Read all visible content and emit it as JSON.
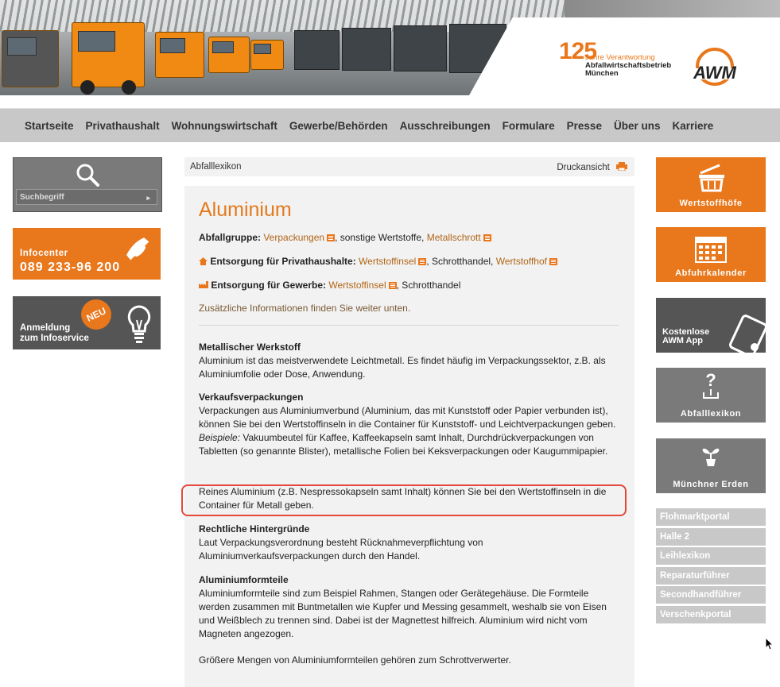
{
  "header": {
    "jubilee_number": "125",
    "jubilee_line1": "Jahre Verantwortung",
    "jubilee_line2": "Abfallwirtschaftsbetrieb",
    "jubilee_line3": "München",
    "logo_text": "AWM"
  },
  "nav": {
    "items": [
      "Startseite",
      "Privathaushalt",
      "Wohnungswirtschaft",
      "Gewerbe/Behörden",
      "Ausschreibungen",
      "Formulare",
      "Presse",
      "Über uns",
      "Karriere"
    ]
  },
  "left": {
    "search_placeholder": "Suchbegriff",
    "infocenter_title": "Infocenter",
    "infocenter_phone": "089 233-96 200",
    "neu_badge": "NEU",
    "anmeldung_line1": "Anmeldung",
    "anmeldung_line2": "zum Infoservice"
  },
  "main": {
    "breadcrumb": "Abfalllexikon",
    "print_label": "Druckansicht",
    "title": "Aluminium",
    "abfallgruppe_label": "Abfallgruppe:",
    "abfallgruppe_link1": "Verpackungen",
    "abfallgruppe_text": ", sonstige Wertstoffe,",
    "abfallgruppe_link2": "Metallschrott",
    "privat_label": "Entsorgung für Privathaushalte:",
    "privat_link1": "Wertstoffinsel",
    "privat_text": ", Schrotthandel,",
    "privat_link2": "Wertstoffhof",
    "gewerbe_label": "Entsorgung für Gewerbe:",
    "gewerbe_link1": "Wertstoffinsel",
    "gewerbe_text": ", Schrotthandel",
    "zusatz": "Zusätzliche Informationen finden Sie weiter unten.",
    "s1_title": "Metallischer Werkstoff",
    "s1_text": "Aluminium ist das meistverwendete Leichtmetall. Es findet häufig im Verpackungssektor, z.B. als Aluminiumfolie oder Dose, Anwendung.",
    "s2_title": "Verkaufsverpackungen",
    "s2_text_a": "Verpackungen aus Aluminiumverbund (Aluminium, das mit Kunststoff oder Papier verbunden ist), können Sie bei den Wertstoffinseln in die Container für Kunststoff- und Leichtverpackungen geben.",
    "s2_beispiele": "Beispiele:",
    "s2_text_b": "Vakuumbeutel für Kaffee, Kaffeekapseln samt Inhalt, Durchdrückverpackungen von Tabletten (so genannte Blister), metallische Folien bei Keksverpackungen oder Kaugummipapier.",
    "s3_text": "Reines Aluminium (z.B. Nespressokapseln samt Inhalt) können Sie bei den Wertstoffinseln in die Container für Metall geben.",
    "s4_title": "Rechtliche Hintergründe",
    "s4_text": "Laut Verpackungsverordnung besteht Rücknahmeverpflichtung von Aluminiumverkaufsverpackungen durch den Handel.",
    "s5_title": "Aluminiumformteile",
    "s5_text": "Aluminiumformteile sind zum Beispiel Rahmen, Stangen oder Gerätegehäuse.  Die Formteile werden zusammen mit Buntmetallen wie Kupfer und Messing gesammelt, weshalb sie von Eisen und Weißblech zu trennen sind. Dabei ist der Magnettest hilfreich. Aluminium wird nicht vom Magneten angezogen.",
    "s6_text": "Größere Mengen von Aluminiumformteilen gehören zum Schrottverwerter."
  },
  "right": {
    "wertstoffhoefe": "Wertstoffhöfe",
    "abfuhrkalender": "Abfuhrkalender",
    "app_line1": "Kostenlose",
    "app_line2": "AWM App",
    "abfalllexikon": "Abfalllexikon",
    "erden": "Münchner Erden",
    "links": [
      "Flohmarktportal",
      "Halle 2",
      "Leihlexikon",
      "Reparaturführer",
      "Secondhandführer",
      "Verschenkportal"
    ]
  },
  "colors": {
    "brand_orange": "#e9771b",
    "title_orange": "#e47a1d",
    "highlight_red": "#e5473d"
  }
}
